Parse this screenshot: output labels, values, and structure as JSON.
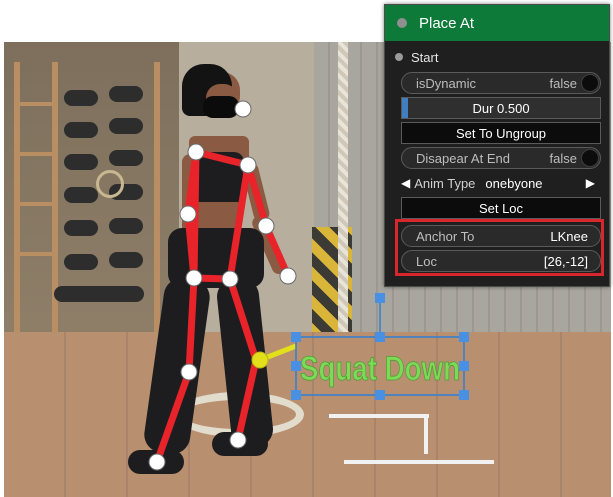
{
  "panel": {
    "title": "Place At",
    "section": "Start",
    "rows": {
      "is_dynamic": {
        "label": "isDynamic",
        "value": "false"
      },
      "duration": {
        "label": "Dur  0.500",
        "progress": 0.03
      },
      "set_ungroup": {
        "label": "Set To Ungroup"
      },
      "disappear": {
        "label": "Disapear At End",
        "value": "false"
      },
      "anim_type": {
        "label": "Anim Type",
        "value": "onebyone",
        "left_arrow": "◀",
        "right_arrow": "▶"
      },
      "set_loc": {
        "label": "Set Loc"
      },
      "anchor_to": {
        "label": "Anchor To",
        "value": "LKnee"
      },
      "loc": {
        "label": "Loc",
        "value": "[26,-12]"
      }
    },
    "colors": {
      "header": "#0e7a3a",
      "highlight": "#d7262c"
    }
  },
  "overlay_text": "Squat Down",
  "colors": {
    "skeleton": "#e8232a",
    "joint": "#ffffff",
    "anchor_dot": "#e3e01b",
    "text": "#7ed957",
    "handle": "#2e7fd6"
  }
}
